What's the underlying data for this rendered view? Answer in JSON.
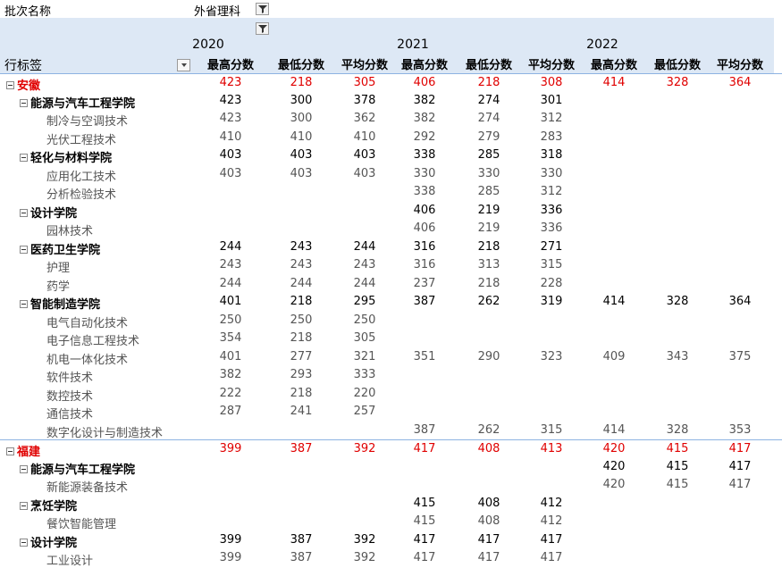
{
  "filter": {
    "field_label": "批次名称",
    "value": "外省理科"
  },
  "header": {
    "row_label": "行标签",
    "years": [
      "2020",
      "2021",
      "2022"
    ],
    "measures": [
      "最高分数",
      "最低分数",
      "平均分数"
    ]
  },
  "rows": [
    {
      "type": "prov",
      "label": "安徽",
      "v": [
        "423",
        "218",
        "305",
        "406",
        "218",
        "308",
        "414",
        "328",
        "364"
      ]
    },
    {
      "type": "college",
      "label": "能源与汽车工程学院",
      "v": [
        "423",
        "300",
        "378",
        "382",
        "274",
        "301",
        "",
        "",
        ""
      ]
    },
    {
      "type": "major",
      "label": "制冷与空调技术",
      "v": [
        "423",
        "300",
        "362",
        "382",
        "274",
        "312",
        "",
        "",
        ""
      ]
    },
    {
      "type": "major",
      "label": "光伏工程技术",
      "v": [
        "410",
        "410",
        "410",
        "292",
        "279",
        "283",
        "",
        "",
        ""
      ]
    },
    {
      "type": "college",
      "label": "轻化与材料学院",
      "v": [
        "403",
        "403",
        "403",
        "338",
        "285",
        "318",
        "",
        "",
        ""
      ]
    },
    {
      "type": "major",
      "label": "应用化工技术",
      "v": [
        "403",
        "403",
        "403",
        "330",
        "330",
        "330",
        "",
        "",
        ""
      ]
    },
    {
      "type": "major",
      "label": "分析检验技术",
      "v": [
        "",
        "",
        "",
        "338",
        "285",
        "312",
        "",
        "",
        ""
      ]
    },
    {
      "type": "college",
      "label": "设计学院",
      "v": [
        "",
        "",
        "",
        "406",
        "219",
        "336",
        "",
        "",
        ""
      ]
    },
    {
      "type": "major",
      "label": "园林技术",
      "v": [
        "",
        "",
        "",
        "406",
        "219",
        "336",
        "",
        "",
        ""
      ]
    },
    {
      "type": "college",
      "label": "医药卫生学院",
      "v": [
        "244",
        "243",
        "244",
        "316",
        "218",
        "271",
        "",
        "",
        ""
      ]
    },
    {
      "type": "major",
      "label": "护理",
      "v": [
        "243",
        "243",
        "243",
        "316",
        "313",
        "315",
        "",
        "",
        ""
      ]
    },
    {
      "type": "major",
      "label": "药学",
      "v": [
        "244",
        "244",
        "244",
        "237",
        "218",
        "228",
        "",
        "",
        ""
      ]
    },
    {
      "type": "college",
      "label": "智能制造学院",
      "v": [
        "401",
        "218",
        "295",
        "387",
        "262",
        "319",
        "414",
        "328",
        "364"
      ]
    },
    {
      "type": "major",
      "label": "电气自动化技术",
      "v": [
        "250",
        "250",
        "250",
        "",
        "",
        "",
        "",
        "",
        ""
      ]
    },
    {
      "type": "major",
      "label": "电子信息工程技术",
      "v": [
        "354",
        "218",
        "305",
        "",
        "",
        "",
        "",
        "",
        ""
      ]
    },
    {
      "type": "major",
      "label": "机电一体化技术",
      "v": [
        "401",
        "277",
        "321",
        "351",
        "290",
        "323",
        "409",
        "343",
        "375"
      ]
    },
    {
      "type": "major",
      "label": "软件技术",
      "v": [
        "382",
        "293",
        "333",
        "",
        "",
        "",
        "",
        "",
        ""
      ]
    },
    {
      "type": "major",
      "label": "数控技术",
      "v": [
        "222",
        "218",
        "220",
        "",
        "",
        "",
        "",
        "",
        ""
      ]
    },
    {
      "type": "major",
      "label": "通信技术",
      "v": [
        "287",
        "241",
        "257",
        "",
        "",
        "",
        "",
        "",
        ""
      ]
    },
    {
      "type": "major",
      "label": "数字化设计与制造技术",
      "v": [
        "",
        "",
        "",
        "387",
        "262",
        "315",
        "414",
        "328",
        "353"
      ]
    },
    {
      "type": "prov",
      "label": "福建",
      "v": [
        "399",
        "387",
        "392",
        "417",
        "408",
        "413",
        "420",
        "415",
        "417"
      ]
    },
    {
      "type": "college",
      "label": "能源与汽车工程学院",
      "v": [
        "",
        "",
        "",
        "",
        "",
        "",
        "420",
        "415",
        "417"
      ]
    },
    {
      "type": "major",
      "label": "新能源装备技术",
      "v": [
        "",
        "",
        "",
        "",
        "",
        "",
        "420",
        "415",
        "417"
      ]
    },
    {
      "type": "college",
      "label": "烹饪学院",
      "v": [
        "",
        "",
        "",
        "415",
        "408",
        "412",
        "",
        "",
        ""
      ]
    },
    {
      "type": "major",
      "label": "餐饮智能管理",
      "v": [
        "",
        "",
        "",
        "415",
        "408",
        "412",
        "",
        "",
        ""
      ]
    },
    {
      "type": "college",
      "label": "设计学院",
      "v": [
        "399",
        "387",
        "392",
        "417",
        "417",
        "417",
        "",
        "",
        ""
      ]
    },
    {
      "type": "major",
      "label": "工业设计",
      "v": [
        "399",
        "387",
        "392",
        "417",
        "417",
        "417",
        "",
        "",
        ""
      ]
    }
  ]
}
